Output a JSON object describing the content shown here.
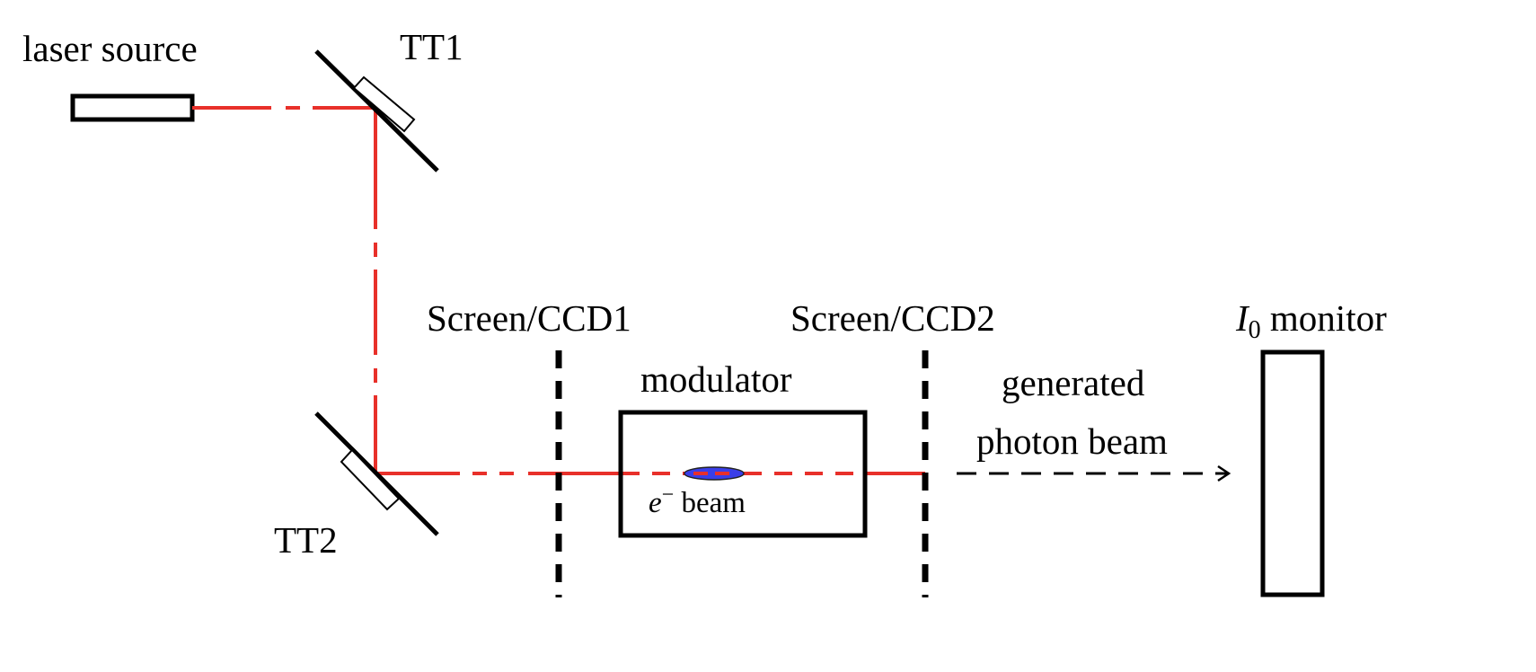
{
  "labels": {
    "laser_source": "laser source",
    "tt1": "TT1",
    "tt2": "TT2",
    "screen1": "Screen/CCD1",
    "screen2": "Screen/CCD2",
    "monitor_symbol": "I",
    "monitor_subscript": "0",
    "monitor_text": " monitor",
    "modulator": "modulator",
    "e_symbol": "e",
    "e_sup": "−",
    "e_text": " beam",
    "generated": "generated",
    "photon_beam": "photon beam"
  },
  "colors": {
    "laser": "#e8302a",
    "electron_beam": "#3a3ee8",
    "outline": "#000000"
  }
}
